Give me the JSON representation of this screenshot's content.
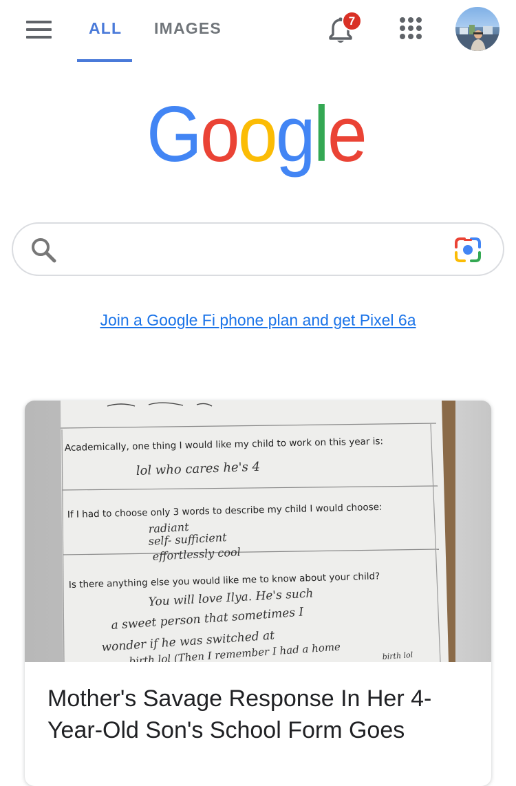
{
  "header": {
    "tabs": [
      {
        "label": "ALL",
        "active": true
      },
      {
        "label": "IMAGES",
        "active": false
      }
    ],
    "notification_count": "7",
    "icons": [
      "menu-icon",
      "bell-icon",
      "apps-grid-icon",
      "account-avatar"
    ]
  },
  "logo": {
    "text": "Google",
    "colors": [
      "#4285F4",
      "#EA4335",
      "#FBBC05",
      "#4285F4",
      "#34A853",
      "#EA4335"
    ]
  },
  "search": {
    "value": "",
    "placeholder": "",
    "icons": [
      "search-icon",
      "google-lens-icon"
    ]
  },
  "promo": {
    "link_text": "Join a Google Fi phone plan and get Pixel 6a"
  },
  "card": {
    "image": {
      "form_questions": [
        "Academically, one thing I would like my child to work on this year is:",
        "If I had to choose only 3 words to describe my child I would choose:",
        "Is there anything else you would like me to know about your child?"
      ],
      "handwritten_answers": [
        "lol who cares he's 4",
        "radiant",
        "self- sufficient",
        "effortlessly cool",
        "You will love Ilya. He's such",
        "a sweet person that sometimes I",
        "wonder if he was switched at",
        "birth lol (Then I remember I had a home",
        "birth lol"
      ]
    },
    "title": "Mother's Savage Response In Her 4-Year-Old Son's School Form Goes"
  },
  "colors": {
    "accent": "#4a7ad9",
    "link": "#1a73e8",
    "badge": "#d93025",
    "icon_gray": "#5f6368"
  }
}
